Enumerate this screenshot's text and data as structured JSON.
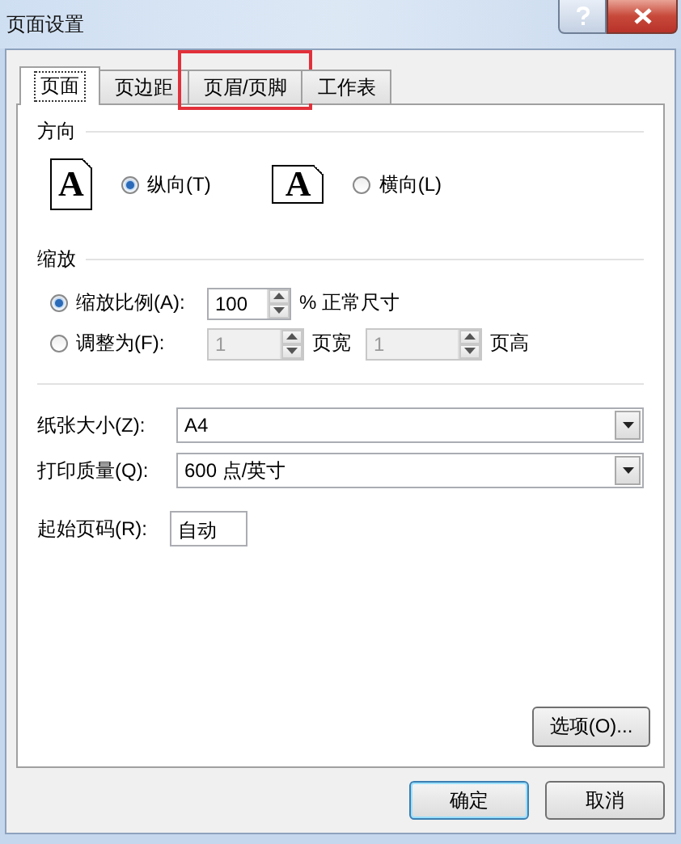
{
  "window": {
    "title": "页面设置"
  },
  "tabs": [
    {
      "label": "页面",
      "selected": true,
      "highlighted": false
    },
    {
      "label": "页边距",
      "selected": false,
      "highlighted": false
    },
    {
      "label": "页眉/页脚",
      "selected": false,
      "highlighted": true
    },
    {
      "label": "工作表",
      "selected": false,
      "highlighted": false
    }
  ],
  "orientation": {
    "title": "方向",
    "options": [
      {
        "label": "纵向(T)",
        "selected": true,
        "kind": "portrait",
        "icon_letter": "A"
      },
      {
        "label": "横向(L)",
        "selected": false,
        "kind": "landscape",
        "icon_letter": "A"
      }
    ]
  },
  "scaling": {
    "title": "缩放",
    "options": [
      {
        "label": "缩放比例(A):",
        "selected": true,
        "fields": [
          {
            "value": "100",
            "disabled": false,
            "suffix": "% 正常尺寸"
          }
        ]
      },
      {
        "label": "调整为(F):",
        "selected": false,
        "fields": [
          {
            "value": "1",
            "disabled": true,
            "suffix": "页宽"
          },
          {
            "value": "1",
            "disabled": true,
            "suffix": "页高"
          }
        ]
      }
    ]
  },
  "paper_size": {
    "label": "纸张大小(Z):",
    "value": "A4"
  },
  "print_quality": {
    "label": "打印质量(Q):",
    "value": "600 点/英寸"
  },
  "first_page_number": {
    "label": "起始页码(R):",
    "value": "自动"
  },
  "options_button": "选项(O)...",
  "buttons": [
    "确定",
    "取消"
  ]
}
